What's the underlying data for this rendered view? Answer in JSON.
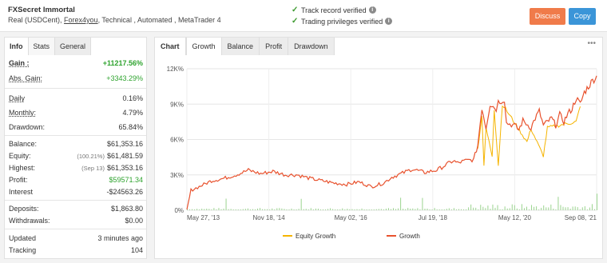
{
  "header": {
    "title": "FXSecret Immortal",
    "account": "Real (USDCent),",
    "broker": "Forex4you",
    "tags": ", Technical , Automated , MetaTrader 4",
    "verify1": "Track record verified",
    "verify2": "Trading privileges verified",
    "discuss": "Discuss",
    "copy": "Copy"
  },
  "left_tabs": [
    "Info",
    "Stats",
    "General"
  ],
  "stats": {
    "gain_l": "Gain :",
    "gain_v": "+11217.56%",
    "absgain_l": "Abs. Gain:",
    "absgain_v": "+3343.29%",
    "daily_l": "Daily",
    "daily_v": "0.16%",
    "monthly_l": "Monthly:",
    "monthly_v": "4.79%",
    "drawdown_l": "Drawdown:",
    "drawdown_v": "65.84%",
    "balance_l": "Balance:",
    "balance_v": "$61,353.16",
    "equity_l": "Equity:",
    "equity_pre": "(100.21%)",
    "equity_v": "$61,481.59",
    "highest_l": "Highest:",
    "highest_pre": "(Sep 13)",
    "highest_v": "$61,353.16",
    "profit_l": "Profit:",
    "profit_v": "$59571.34",
    "interest_l": "Interest",
    "interest_v": "-$24563.26",
    "deposits_l": "Deposits:",
    "deposits_v": "$1,863.80",
    "withdrawals_l": "Withdrawals:",
    "withdrawals_v": "$0.00",
    "updated_l": "Updated",
    "updated_v": "3 minutes ago",
    "tracking_l": "Tracking",
    "tracking_v": "104"
  },
  "chart_tabs": {
    "head": "Chart",
    "tabs": [
      "Growth",
      "Balance",
      "Profit",
      "Drawdown"
    ],
    "more": "•••"
  },
  "colors": {
    "growth": "#e8522e",
    "equity": "#f5b400",
    "volume": "#9bd48f",
    "green": "#2fa32f",
    "discuss": "#f07b4a",
    "copy": "#3b95d8"
  },
  "chart_data": {
    "type": "line",
    "title": "",
    "ylabel": "",
    "xlabel": "",
    "y_ticks": [
      "12K%",
      "9K%",
      "6K%",
      "3K%",
      "0%"
    ],
    "x_ticks": [
      "May 27, '13",
      "Nov 18, '14",
      "May 02, '16",
      "Jul 19, '18",
      "May 12, '20",
      "Sep 08, '21"
    ],
    "ylim": [
      0,
      12000
    ],
    "legend_position": "bottom",
    "grid": true,
    "series": [
      {
        "name": "Growth",
        "points": [
          [
            0.0,
            0
          ],
          [
            0.01,
            1700
          ],
          [
            0.03,
            2000
          ],
          [
            0.06,
            2500
          ],
          [
            0.09,
            2700
          ],
          [
            0.12,
            3000
          ],
          [
            0.15,
            3400
          ],
          [
            0.18,
            3100
          ],
          [
            0.21,
            3300
          ],
          [
            0.24,
            3000
          ],
          [
            0.27,
            3000
          ],
          [
            0.3,
            2700
          ],
          [
            0.33,
            2500
          ],
          [
            0.36,
            2300
          ],
          [
            0.39,
            2200
          ],
          [
            0.42,
            2400
          ],
          [
            0.45,
            2000
          ],
          [
            0.48,
            2300
          ],
          [
            0.5,
            2800
          ],
          [
            0.53,
            3200
          ],
          [
            0.55,
            3500
          ],
          [
            0.58,
            3200
          ],
          [
            0.61,
            3400
          ],
          [
            0.63,
            3800
          ],
          [
            0.65,
            4200
          ],
          [
            0.66,
            4000
          ],
          [
            0.68,
            4200
          ],
          [
            0.7,
            4300
          ],
          [
            0.71,
            5500
          ],
          [
            0.72,
            8700
          ],
          [
            0.73,
            7000
          ],
          [
            0.74,
            9000
          ],
          [
            0.755,
            8600
          ],
          [
            0.76,
            9200
          ],
          [
            0.775,
            9400
          ],
          [
            0.78,
            7400
          ],
          [
            0.8,
            7200
          ],
          [
            0.81,
            6800
          ],
          [
            0.82,
            7600
          ],
          [
            0.84,
            7000
          ],
          [
            0.85,
            7800
          ],
          [
            0.86,
            8400
          ],
          [
            0.87,
            7200
          ],
          [
            0.88,
            7500
          ],
          [
            0.89,
            7800
          ],
          [
            0.9,
            7200
          ],
          [
            0.91,
            8100
          ],
          [
            0.92,
            7500
          ],
          [
            0.93,
            8200
          ],
          [
            0.94,
            8600
          ],
          [
            0.95,
            9500
          ],
          [
            0.96,
            9000
          ],
          [
            0.97,
            10000
          ],
          [
            0.98,
            10500
          ],
          [
            0.99,
            11000
          ],
          [
            1.0,
            11400
          ]
        ]
      },
      {
        "name": "Equity Growth",
        "points": [
          [
            0.71,
            5200
          ],
          [
            0.72,
            8000
          ],
          [
            0.725,
            3700
          ],
          [
            0.73,
            7000
          ],
          [
            0.745,
            4600
          ],
          [
            0.75,
            8600
          ],
          [
            0.76,
            3800
          ],
          [
            0.77,
            9000
          ],
          [
            0.83,
            5800
          ],
          [
            0.84,
            6900
          ],
          [
            0.87,
            4600
          ],
          [
            0.88,
            7000
          ],
          [
            0.95,
            7500
          ],
          [
            0.96,
            8800
          ]
        ]
      }
    ]
  },
  "legend": {
    "equity": "Equity Growth",
    "growth": "Growth"
  }
}
